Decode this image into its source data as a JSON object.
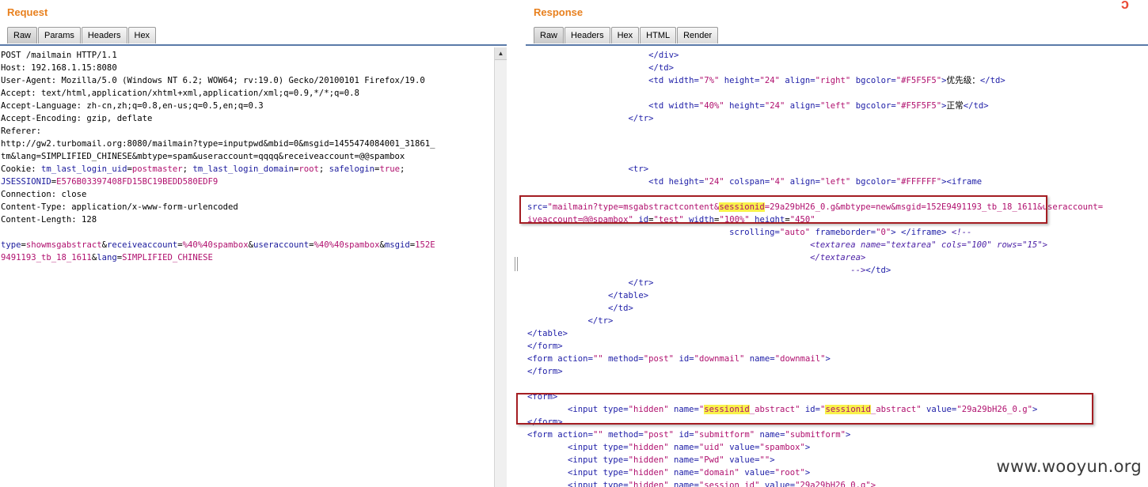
{
  "request": {
    "title": "Request",
    "tabs": [
      "Raw",
      "Params",
      "Headers",
      "Hex"
    ],
    "lines": {
      "l0": "POST /mailmain HTTP/1.1",
      "l1": "Host: 192.168.1.15:8080",
      "l2": "User-Agent: Mozilla/5.0 (Windows NT 6.2; WOW64; rv:19.0) Gecko/20100101 Firefox/19.0",
      "l3": "Accept: text/html,application/xhtml+xml,application/xml;q=0.9,*/*;q=0.8",
      "l4": "Accept-Language: zh-cn,zh;q=0.8,en-us;q=0.5,en;q=0.3",
      "l5": "Accept-Encoding: gzip, deflate",
      "l6": "Referer:",
      "l7": "http://gw2.turbomail.org:8080/mailmain?type=inputpwd&mbid=0&msgid=1455474084001_31861_",
      "l8": "tm&lang=SIMPLIFIED_CHINESE&mbtype=spam&useraccount=qqqq&receiveaccount=@@spambox",
      "connection": "Connection: close",
      "content_type": "Content-Type: application/x-www-form-urlencoded",
      "content_length": "Content-Length: 128"
    },
    "cookie": {
      "label": "Cookie: ",
      "k1": "tm_last_login_uid",
      "v1": "postmaster",
      "k2": "tm_last_login_domain",
      "v2": "root",
      "k3": "safelogin",
      "v3": "true",
      "k4": "JSESSIONID",
      "v4": "E576B03397408FD15BC19BEDD580EDF9"
    },
    "body": {
      "k1": "type",
      "v1": "showmsgabstract",
      "k2": "receiveaccount",
      "v2": "%40%40spambox",
      "k3": "useraccount",
      "v3": "%40%40spambox",
      "k4": "msgid",
      "v4a": "152E",
      "v4b": "9491193_tb_18_1611",
      "k5": "lang",
      "v5": "SIMPLIFIED_CHINESE"
    }
  },
  "response": {
    "title": "Response",
    "tabs": [
      "Raw",
      "Headers",
      "Hex",
      "HTML",
      "Render"
    ],
    "txt": {
      "priority_label": "优先级：",
      "normal_label": "正常",
      "w7": "\"7%\"",
      "h24": "\"24\"",
      "right": "\"right\"",
      "bg5": "\"#F5F5F5\"",
      "w40": "\"40%\"",
      "left": "\"left\"",
      "col4": "\"4\"",
      "bgF": "\"#FFFFFF\"",
      "src_pre": "\"mailmain?type=msgabstractcontent&",
      "src_hl": "sessionid",
      "src_post": "=29a29bH26_0.g&mbtype=new&msgid=152E9491193_tb_18_1611&useraccount=",
      "recv_line": "iveaccount=@@spambox\"",
      "id_test": "\"test\"",
      "w100": "\"100%\"",
      "h450": "\"450\"",
      "auto": "\"auto\"",
      "zero": "\"0\"",
      "ta_name": "\"textarea\"",
      "c100": "\"100\"",
      "r15": "\"15\"",
      "empty": "\"\"",
      "post": "\"post\"",
      "downmail": "\"downmail\"",
      "hidden": "\"hidden\"",
      "sid_hl": "sessionid",
      "sid_suffix": "_abstract",
      "sid_value": "\"29a29bH26_0.g\"",
      "submitform": "\"submitform\"",
      "uid": "\"uid\"",
      "spambox": "\"spambox\"",
      "pwd": "\"Pwd\"",
      "domain": "\"domain\"",
      "root": "\"root\"",
      "session_id": "\"session_id\"",
      "sess_val_cut": "\"29a29bH26_0.g\">"
    }
  },
  "watermark": "www.wooyun.org"
}
